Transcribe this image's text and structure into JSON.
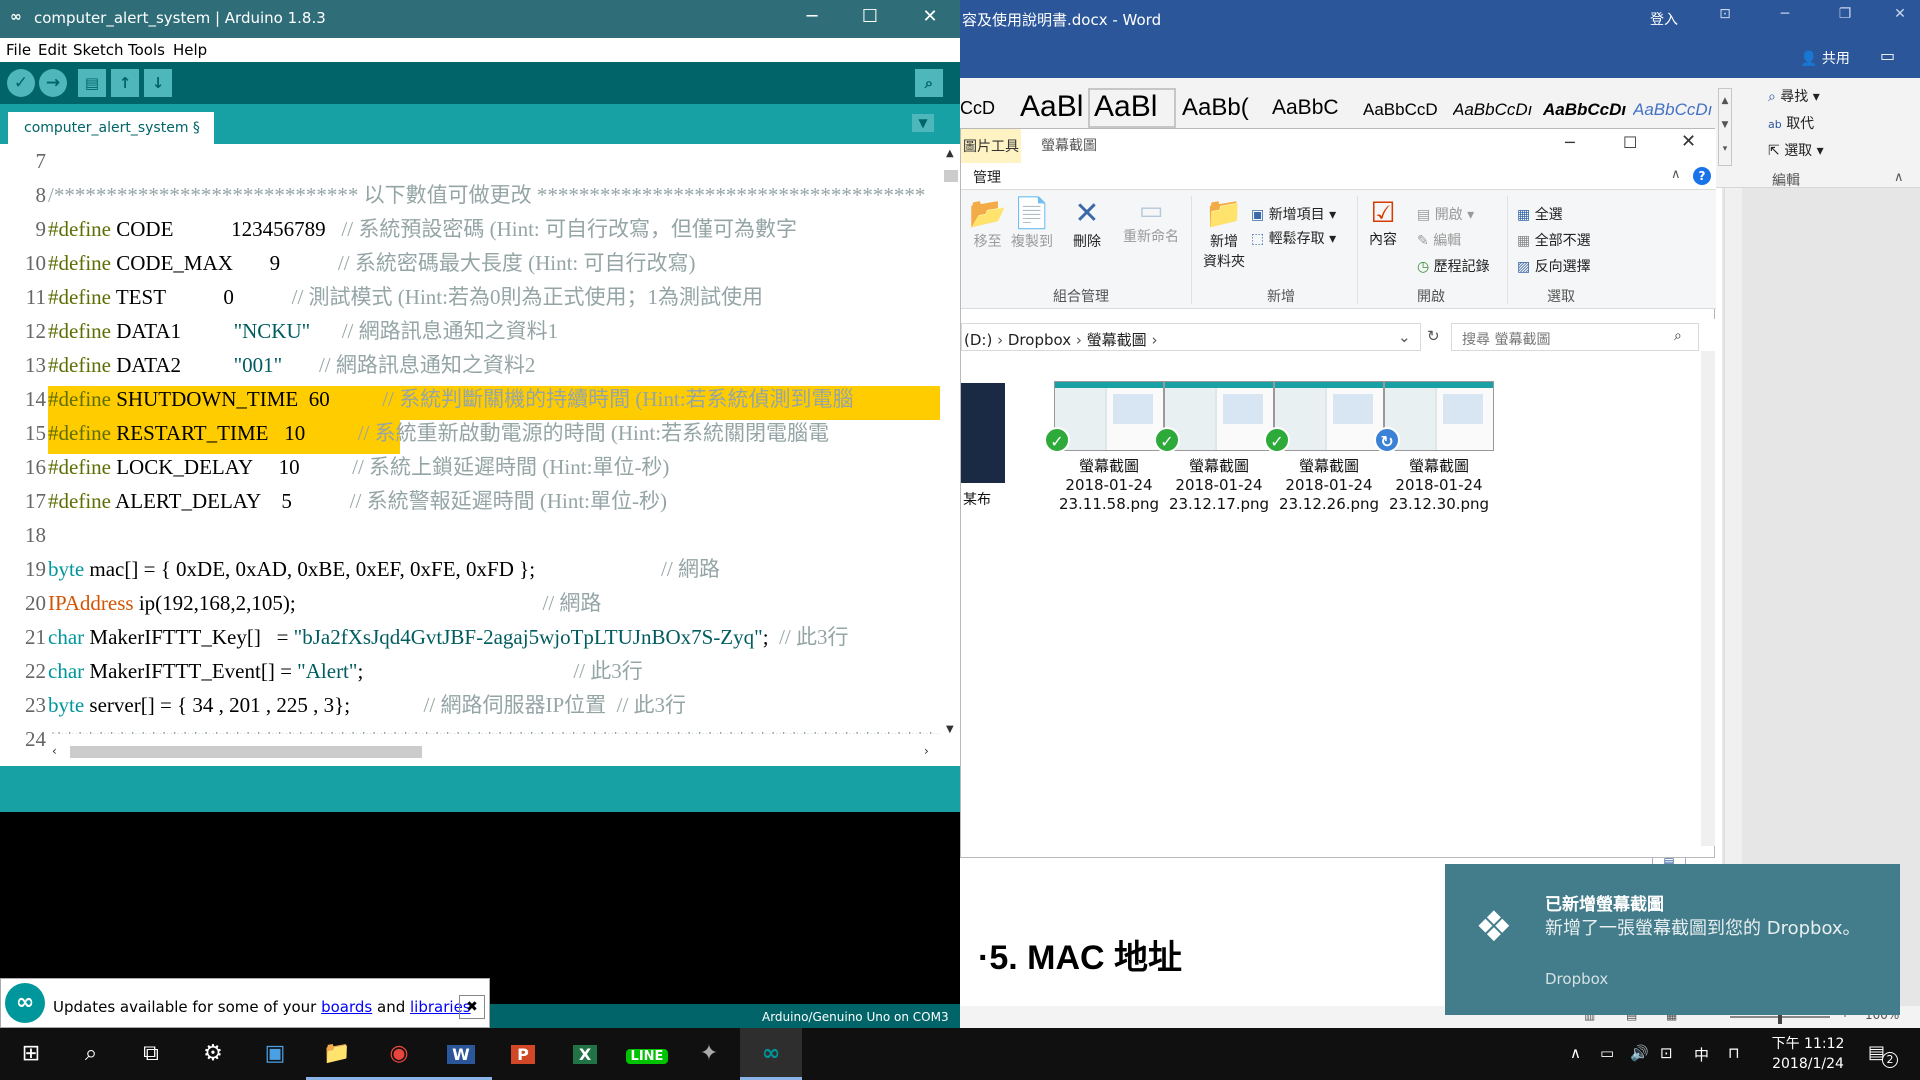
{
  "arduino": {
    "title": "computer_alert_system | Arduino 1.8.3",
    "menu": [
      "File",
      "Edit",
      "Sketch",
      "Tools",
      "Help"
    ],
    "tab": "computer_alert_system §",
    "lines": [
      {
        "n": "7",
        "t": ""
      },
      {
        "n": "8",
        "t": "/***************************** 以下數值可做更改 *************************************"
      },
      {
        "n": "9",
        "t": "#define CODE           123456789   // 系統預設密碼 (Hint: 可自行改寫，但僅可為數字"
      },
      {
        "n": "10",
        "t": "#define CODE_MAX       9           // 系統密碼最大長度 (Hint: 可自行改寫)"
      },
      {
        "n": "11",
        "t": "#define TEST           0           // 測試模式 (Hint:若為0則為正式使用；1為測試使用"
      },
      {
        "n": "12",
        "t": "#define DATA1          \"NCKU\"      // 網路訊息通知之資料1"
      },
      {
        "n": "13",
        "t": "#define DATA2          \"001\"       // 網路訊息通知之資料2"
      },
      {
        "n": "14",
        "t": "#define SHUTDOWN_TIME  60          // 系統判斷關機的持續時間 (Hint:若系統偵測到電腦"
      },
      {
        "n": "15",
        "t": "#define RESTART_TIME   10          // 系統重新啟動電源的時間 (Hint:若系統關閉電腦電"
      },
      {
        "n": "16",
        "t": "#define LOCK_DELAY     10          // 系統上鎖延遲時間 (Hint:單位-秒)"
      },
      {
        "n": "17",
        "t": "#define ALERT_DELAY    5           // 系統警報延遲時間 (Hint:單位-秒)"
      },
      {
        "n": "18",
        "t": ""
      },
      {
        "n": "19",
        "t": "byte mac[] = { 0xDE, 0xAD, 0xBE, 0xEF, 0xFE, 0xFD };                        // 網路"
      },
      {
        "n": "20",
        "t": "IPAddress ip(192,168,2,105);                                               // 網路"
      },
      {
        "n": "21",
        "t": "char MakerIFTTT_Key[]   = \"bJa2fXsJqd4GvtJBF-2agaj5wjoTpLTUJnBOx7S-Zyq\";  // 此3行"
      },
      {
        "n": "22",
        "t": "char MakerIFTTT_Event[] = \"Alert\";                                        // 此3行"
      },
      {
        "n": "23",
        "t": "byte server[] = { 34 , 201 , 225 , 3};              // 網路伺服器IP位置  // 此3行"
      },
      {
        "n": "24",
        "t": "/*************************************************************************************"
      }
    ],
    "notification": {
      "prefix": "Updates available for some of your ",
      "link1": "boards",
      "mid": " and ",
      "link2": "libraries"
    },
    "board_status": "Arduino/Genuino Uno on COM3"
  },
  "word": {
    "title": "容及使用說明書.docx - Word",
    "signin": "登入",
    "share": "共用",
    "styles": [
      "CcD",
      "AaBl",
      "AaBl",
      "AaBb(",
      "AaBbC",
      "AaBbCcD",
      "AaBbCcDı",
      "AaBbCcDı",
      "AaBbCcDı"
    ],
    "edit_items": [
      "尋找",
      "取代",
      "選取"
    ],
    "edit_group": "編輯",
    "heading": "·5.  MAC 地址",
    "zoom": "100%"
  },
  "explorer": {
    "picture_tools": "圖片工具",
    "context_title": "螢幕截圖",
    "manage_tab": "管理",
    "organize": {
      "move_to": "移至",
      "copy_to": "複製到",
      "delete": "刪除",
      "rename": "重新命名",
      "group": "組合管理"
    },
    "new": {
      "new_item": "新增項目",
      "easy_access": "輕鬆存取",
      "new_folder_1": "新增",
      "new_folder_2": "資料夾",
      "group": "新增"
    },
    "open": {
      "properties": "內容",
      "open": "開啟",
      "edit": "編輯",
      "history": "歷程記錄",
      "group": "開啟"
    },
    "select": {
      "select_all": "全選",
      "select_none": "全部不選",
      "invert": "反向選擇",
      "group": "選取"
    },
    "breadcrumb": [
      "(D:)",
      "Dropbox",
      "螢幕截圖"
    ],
    "search_placeholder": "搜尋 螢幕截圖",
    "partial_label": "某布",
    "files": [
      {
        "name1": "螢幕截圖",
        "name2": "2018-01-24",
        "name3": "23.11.58.png",
        "status": "synced"
      },
      {
        "name1": "螢幕截圖",
        "name2": "2018-01-24",
        "name3": "23.12.17.png",
        "status": "synced"
      },
      {
        "name1": "螢幕截圖",
        "name2": "2018-01-24",
        "name3": "23.12.26.png",
        "status": "synced"
      },
      {
        "name1": "螢幕截圖",
        "name2": "2018-01-24",
        "name3": "23.12.30.png",
        "status": "syncing"
      }
    ]
  },
  "toast": {
    "title": "已新增螢幕截圖",
    "body": "新增了一張螢幕截圖到您的 Dropbox。",
    "app": "Dropbox"
  },
  "taskbar": {
    "ime": "中",
    "time": "下午 11:12",
    "date": "2018/1/24",
    "notifications": "2"
  }
}
